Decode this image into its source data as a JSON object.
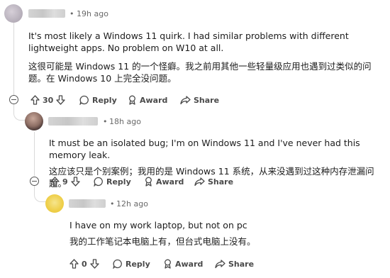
{
  "comments": [
    {
      "time": "19h ago",
      "text_en": "It's most likely a Windows 11 quirk. I had similar problems with different lightweight apps. No problem on W10 at all.",
      "text_zh": "这很可能是 Windows 11 的一个怪癖。我之前用其他一些轻量级应用也遇到过类似的问题。在 Windows 10 上完全没问题。",
      "votes": "30",
      "reply": "Reply",
      "award": "Award",
      "share": "Share"
    },
    {
      "time": "18h ago",
      "text_en": "It must be an isolated bug; I'm on Windows 11 and I've never had this memory leak.",
      "text_zh": "这应该只是个别案例；我用的是 Windows 11 系统，从来没遇到过这种内存泄漏问题。",
      "votes": "9",
      "reply": "Reply",
      "award": "Award",
      "share": "Share"
    },
    {
      "time": "12h ago",
      "text_en": "I have on my work laptop, but not on pc",
      "text_zh": "我的工作笔记本电脑上有，但台式电脑上没有。",
      "votes": "0",
      "reply": "Reply",
      "award": "Award",
      "share": "Share"
    }
  ],
  "separator": "•"
}
